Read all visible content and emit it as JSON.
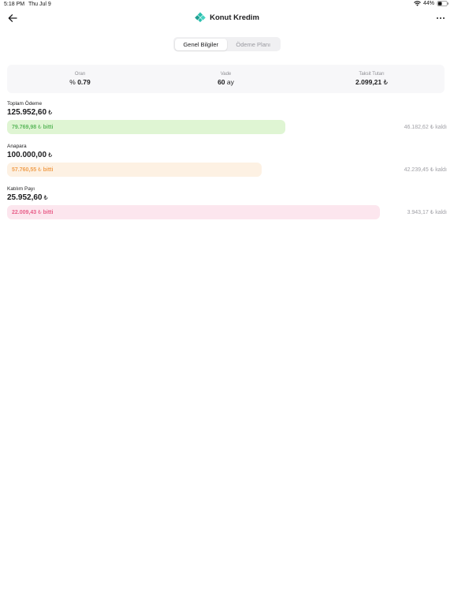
{
  "status_bar": {
    "time": "5:18 PM",
    "date": "Thu Jul 9",
    "battery": "44%",
    "battery_level": 0.44
  },
  "nav": {
    "title": "Konut Kredim",
    "back_icon": "arrow-left-icon",
    "more_icon": "ellipsis-icon",
    "logo_color": "#2bbfae"
  },
  "tabs": [
    {
      "label": "Genel Bilgiler",
      "active": true
    },
    {
      "label": "Ödeme Planı",
      "active": false
    }
  ],
  "summary": {
    "rate": {
      "label": "Oran",
      "prefix": "%",
      "value": "0.79"
    },
    "term": {
      "label": "Vade",
      "value": "60",
      "unit": "ay"
    },
    "installment": {
      "label": "Taksit Tutarı",
      "value": "2.099,21",
      "currency": "₺"
    }
  },
  "sections": [
    {
      "label": "Toplam Ödeme",
      "amount": "125.952,60",
      "currency": "₺",
      "paid": "79.769,98",
      "paid_suffix": "bitti",
      "remaining": "46.182,62",
      "remaining_suffix": "kaldı",
      "paid_fraction": 0.633,
      "bar_color": "#dff5d3",
      "text_color": "#5cb85c"
    },
    {
      "label": "Anapara",
      "amount": "100.000,00",
      "currency": "₺",
      "paid": "57.760,55",
      "paid_suffix": "bitti",
      "remaining": "42.239,45",
      "remaining_suffix": "kaldı",
      "paid_fraction": 0.578,
      "bar_color": "#fdf1e3",
      "text_color": "#f0a050"
    },
    {
      "label": "Katılım Payı",
      "amount": "25.952,60",
      "currency": "₺",
      "paid": "22.009,43",
      "paid_suffix": "bitti",
      "remaining": "3.943,17",
      "remaining_suffix": "kaldı",
      "paid_fraction": 0.848,
      "bar_color": "#fce6ee",
      "text_color": "#e8608a"
    }
  ]
}
